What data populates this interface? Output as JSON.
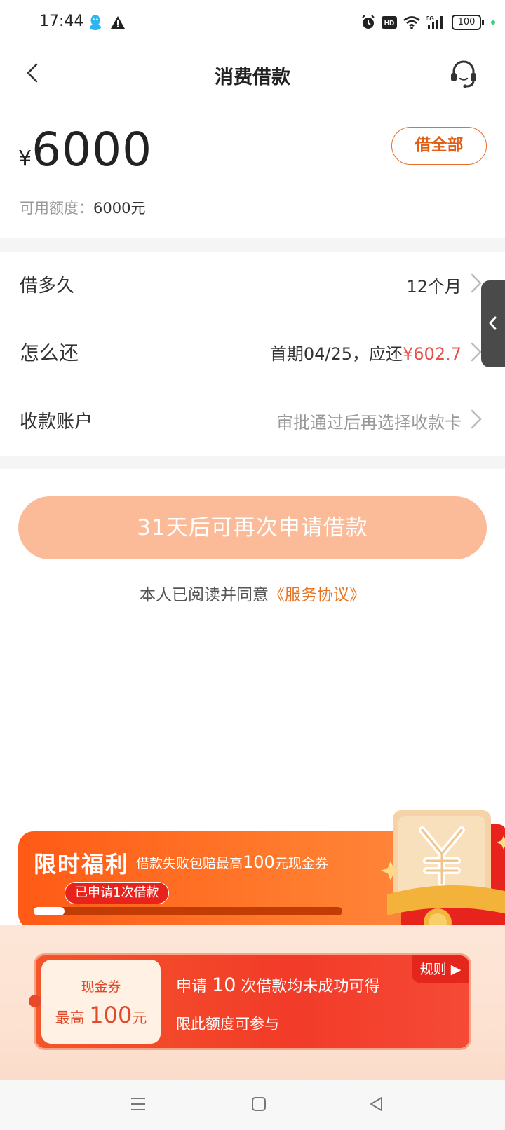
{
  "status_bar": {
    "time": "17:44",
    "icons": [
      "qq-icon",
      "warning-icon",
      "alarm-icon",
      "hd-icon",
      "wifi-icon",
      "5g-signal-icon"
    ],
    "battery": "100",
    "hd_label": "HD",
    "network_label": "5G"
  },
  "nav": {
    "title": "消费借款",
    "back_icon": "chevron-left-icon",
    "service_icon": "headset-icon"
  },
  "amount": {
    "currency": "¥",
    "value": "6000",
    "borrow_all_label": "借全部",
    "credit_label": "可用额度：",
    "credit_value": "6000元"
  },
  "options": {
    "term_label": "借多久",
    "term_value": "12个月",
    "repay_label": "怎么还",
    "repay_value_prefix": "首期04/25，应还",
    "repay_amount": "¥602.7",
    "account_label": "收款账户",
    "account_value": "审批通过后再选择收款卡"
  },
  "submit": {
    "label": "31天后可再次申请借款"
  },
  "agreement": {
    "prefix": "本人已阅读并同意",
    "link": "《服务协议》"
  },
  "promo": {
    "title": "限时福利",
    "subtitle_prefix": "借款失败包赔最高",
    "subtitle_amount": "100",
    "subtitle_suffix": "元现金券",
    "badge": "已申请1次借款",
    "progress_fraction": 0.1
  },
  "coupon": {
    "type": "现金券",
    "amount_prefix": "最高",
    "amount_value": "100",
    "amount_suffix": "元",
    "line1_prefix": "申请",
    "line1_count": "10",
    "line1_suffix": "次借款均未成功可得",
    "line2": "限此额度可参与",
    "rules_label": "规则 ▶"
  },
  "colors": {
    "accent_orange": "#e25e14",
    "submit_disabled": "#fbbb99",
    "repay_red": "#e8504a",
    "promo_orange": "#ff6a22",
    "coupon_red": "#f23b29"
  }
}
